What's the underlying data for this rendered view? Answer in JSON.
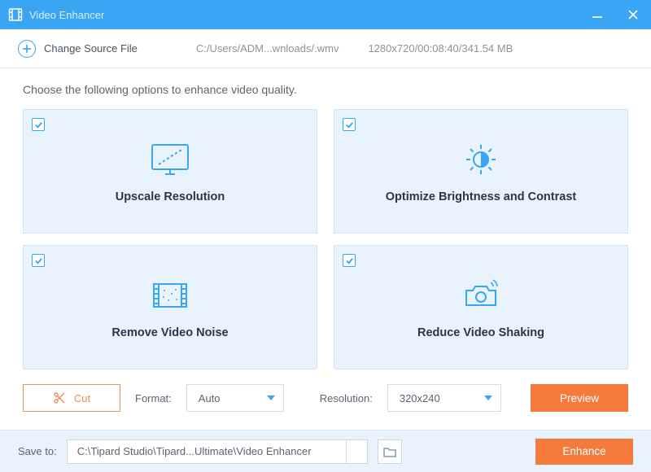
{
  "titlebar": {
    "app_name": "Video Enhancer"
  },
  "sourcebar": {
    "change_label": "Change Source File",
    "path": "C:/Users/ADM...wnloads/.wmv",
    "meta": "1280x720/00:08:40/341.54 MB"
  },
  "instruction": "Choose the following options to enhance video quality.",
  "cards": {
    "upscale": {
      "label": "Upscale Resolution",
      "checked": true
    },
    "brightness": {
      "label": "Optimize Brightness and Contrast",
      "checked": true
    },
    "noise": {
      "label": "Remove Video Noise",
      "checked": true
    },
    "shaking": {
      "label": "Reduce Video Shaking",
      "checked": true
    }
  },
  "controls": {
    "cut_label": "Cut",
    "format_label": "Format:",
    "format_value": "Auto",
    "resolution_label": "Resolution:",
    "resolution_value": "320x240",
    "preview_label": "Preview"
  },
  "footer": {
    "save_label": "Save to:",
    "save_path": "C:\\Tipard Studio\\Tipard...Ultimate\\Video Enhancer",
    "enhance_label": "Enhance"
  }
}
